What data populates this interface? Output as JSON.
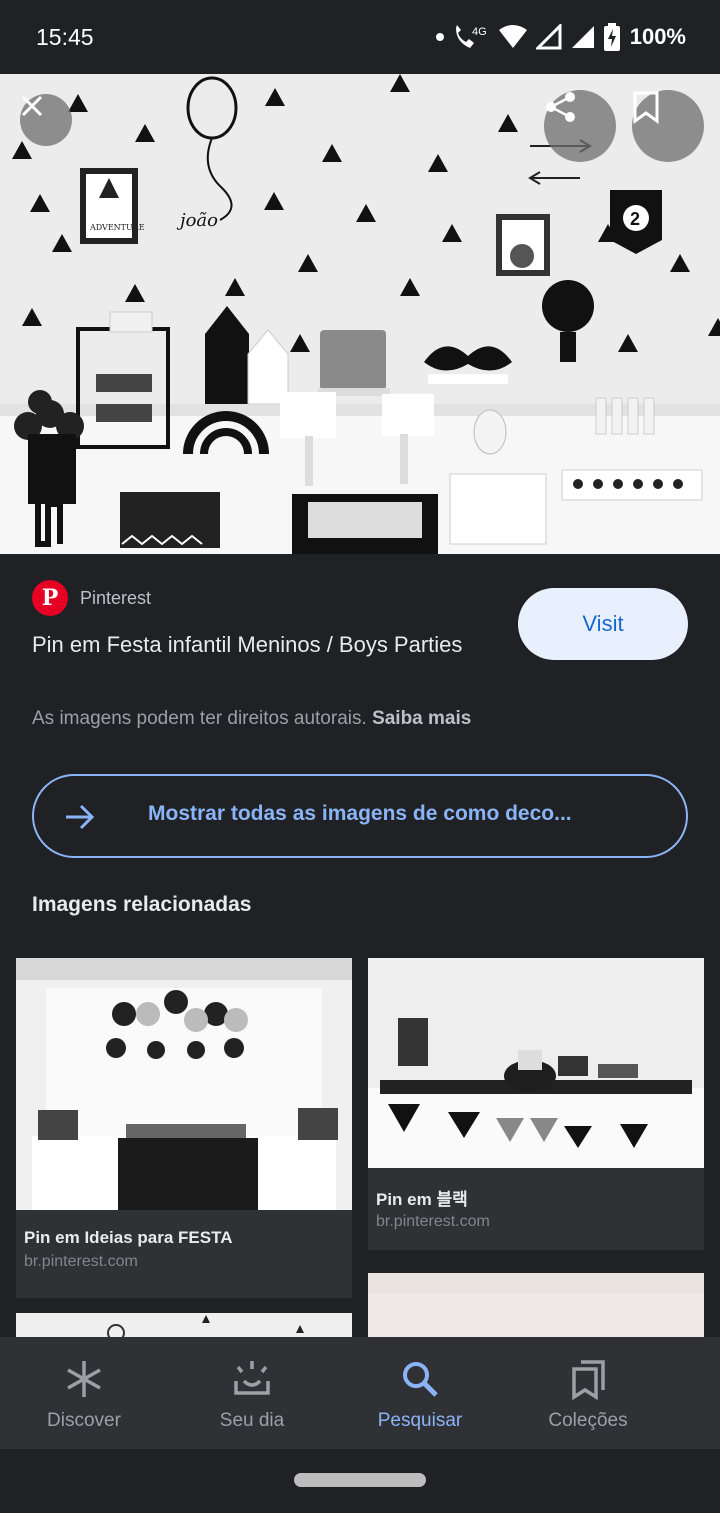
{
  "status_bar": {
    "time": "15:45",
    "network": "4G",
    "battery": "100%"
  },
  "hero": {
    "icons": [
      "close-icon",
      "share-icon",
      "bookmark-icon"
    ],
    "banner_text": "ADVENTURE",
    "name_text": "joão",
    "pennant_number": "2"
  },
  "result": {
    "source_name": "Pinterest",
    "source_logo_letter": "P",
    "title": "Pin em Festa infantil Meninos / Boys Parties",
    "visit_label": "Visit",
    "copyright_text": "As imagens podem ter direitos autorais.",
    "learn_more": "Saiba mais",
    "show_all_label": "Mostrar todas as imagens de como deco..."
  },
  "related": {
    "heading": "Imagens relacionadas",
    "items": [
      {
        "title": "Pin em Ideias para FESTA",
        "source": "br.pinterest.com"
      },
      {
        "title": "Pin em 블랙",
        "source": "br.pinterest.com"
      }
    ]
  },
  "bottom_nav": {
    "items": [
      {
        "label": "Discover",
        "icon": "asterisk-icon",
        "active": false
      },
      {
        "label": "Seu dia",
        "icon": "sunrise-icon",
        "active": false
      },
      {
        "label": "Pesquisar",
        "icon": "search-icon",
        "active": true
      },
      {
        "label": "Coleções",
        "icon": "collections-icon",
        "active": false
      }
    ]
  },
  "colors": {
    "background": "#202124",
    "accent": "#8ab4f8",
    "visit_bg": "#e8f0fe",
    "visit_text": "#1967d2",
    "pinterest_red": "#e60023"
  }
}
